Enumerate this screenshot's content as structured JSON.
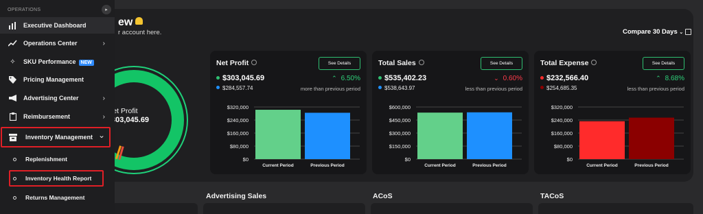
{
  "sidebar": {
    "heading": "OPERATIONS",
    "collapse_icon": "chevron-right-icon",
    "items": [
      {
        "label": "Executive Dashboard",
        "icon": "bar-chart-icon"
      },
      {
        "label": "Operations Center",
        "icon": "trending-up-icon",
        "chevron": "›"
      },
      {
        "label": "SKU Performance",
        "icon": "sparkle-icon",
        "badge": "NEW"
      },
      {
        "label": "Pricing Management",
        "icon": "tag-icon"
      },
      {
        "label": "Advertising Center",
        "icon": "megaphone-icon",
        "chevron": "›"
      },
      {
        "label": "Reimbursement",
        "icon": "clipboard-icon",
        "chevron": "›"
      },
      {
        "label": "Inventory Management",
        "icon": "archive-box-icon",
        "chevron": "⌄"
      }
    ],
    "subitems": [
      {
        "label": "Replenishment"
      },
      {
        "label": "Inventory Health Report"
      },
      {
        "label": "Returns Management"
      }
    ]
  },
  "header": {
    "title": "ew",
    "subtitle": "r account here.",
    "compare_label": "Compare 30 Days"
  },
  "donut": {
    "label": "let Profit",
    "value": "303,045.69",
    "colors": {
      "ring": "#1fd17a",
      "outer": "#18a85f",
      "accent1": "#f39c12",
      "accent2": "#e74c3c"
    }
  },
  "cards": [
    {
      "title": "Net Profit",
      "button": "See Details",
      "current": "$303,045.69",
      "previous": "$284,557.74",
      "change": "6.50%",
      "direction": "up",
      "comparison": "more than previous period",
      "colors": {
        "current": "#63d08a",
        "previous": "#1e90ff"
      }
    },
    {
      "title": "Total Sales",
      "button": "See Details",
      "current": "$535,402.23",
      "previous": "$538,643.97",
      "change": "0.60%",
      "direction": "down",
      "comparison": "less than previous period",
      "colors": {
        "current": "#63d08a",
        "previous": "#1e90ff"
      }
    },
    {
      "title": "Total Expense",
      "button": "See Details",
      "current": "$232,566.40",
      "previous": "$254,685.35",
      "change": "8.68%",
      "direction": "up",
      "comparison": "less than previous period",
      "colors": {
        "current": "#ff2b2b",
        "previous": "#8b0000"
      }
    }
  ],
  "chart_data": [
    {
      "type": "bar",
      "categories": [
        "Current Period",
        "Previous Period"
      ],
      "values": [
        303045.69,
        284557.74
      ],
      "yticks": [
        "$320,000",
        "$240,000",
        "$160,000",
        "$80,000",
        "$0"
      ],
      "ylim": [
        0,
        320000
      ]
    },
    {
      "type": "bar",
      "categories": [
        "Current Period",
        "Previous Period"
      ],
      "values": [
        535402.23,
        538643.97
      ],
      "yticks": [
        "$600,000",
        "$450,000",
        "$300,000",
        "$150,000",
        "$0"
      ],
      "ylim": [
        0,
        600000
      ]
    },
    {
      "type": "bar",
      "categories": [
        "Current Period",
        "Previous Period"
      ],
      "values": [
        232566.4,
        254685.35
      ],
      "yticks": [
        "$320,000",
        "$240,000",
        "$160,000",
        "$80,000",
        "$0"
      ],
      "ylim": [
        0,
        320000
      ]
    }
  ],
  "bottom": {
    "labels": [
      "Advertising Sales",
      "ACoS",
      "TACoS"
    ]
  }
}
